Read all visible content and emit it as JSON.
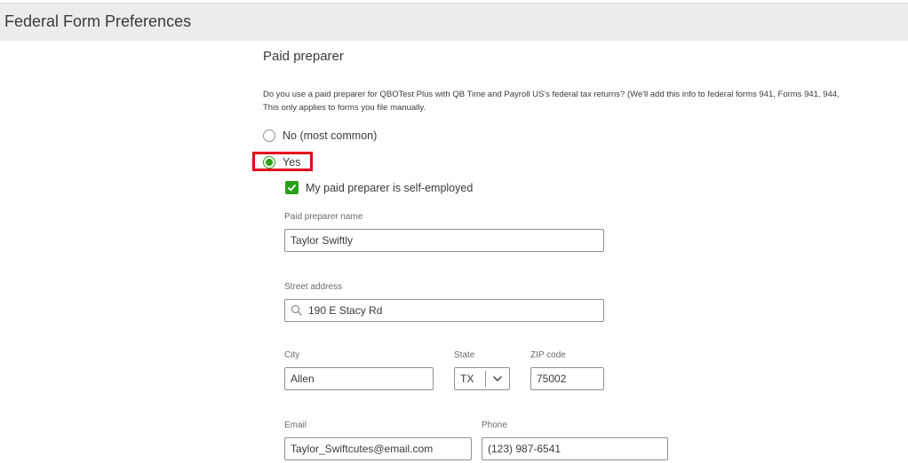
{
  "header": {
    "title": "Federal Form Preferences"
  },
  "section": {
    "title": "Paid preparer"
  },
  "description": {
    "line1": "Do you use a paid preparer for QBOTest Plus with QB Time and Payroll US's federal tax returns? (We'll add this info to federal forms 941, Forms 941, 944,",
    "line2": "This only applies to forms you file manually."
  },
  "radio_no": {
    "label": "No (most common)",
    "selected": false
  },
  "radio_yes": {
    "label": "Yes",
    "selected": true
  },
  "self_employed": {
    "label": "My paid preparer is self-employed",
    "checked": true
  },
  "preparer_name": {
    "label": "Paid preparer name",
    "value": "Taylor Swiftly"
  },
  "street": {
    "label": "Street address",
    "value": "190 E Stacy Rd"
  },
  "city": {
    "label": "City",
    "value": "Allen"
  },
  "state": {
    "label": "State",
    "value": "TX"
  },
  "zip": {
    "label": "ZIP code",
    "value": "75002"
  },
  "email": {
    "label": "Email",
    "value": "Taylor_Swiftcutes@email.com"
  },
  "phone": {
    "label": "Phone",
    "value": "(123) 987-6541"
  },
  "colors": {
    "accent": "#2ca01c",
    "highlight": "#e3001b"
  }
}
